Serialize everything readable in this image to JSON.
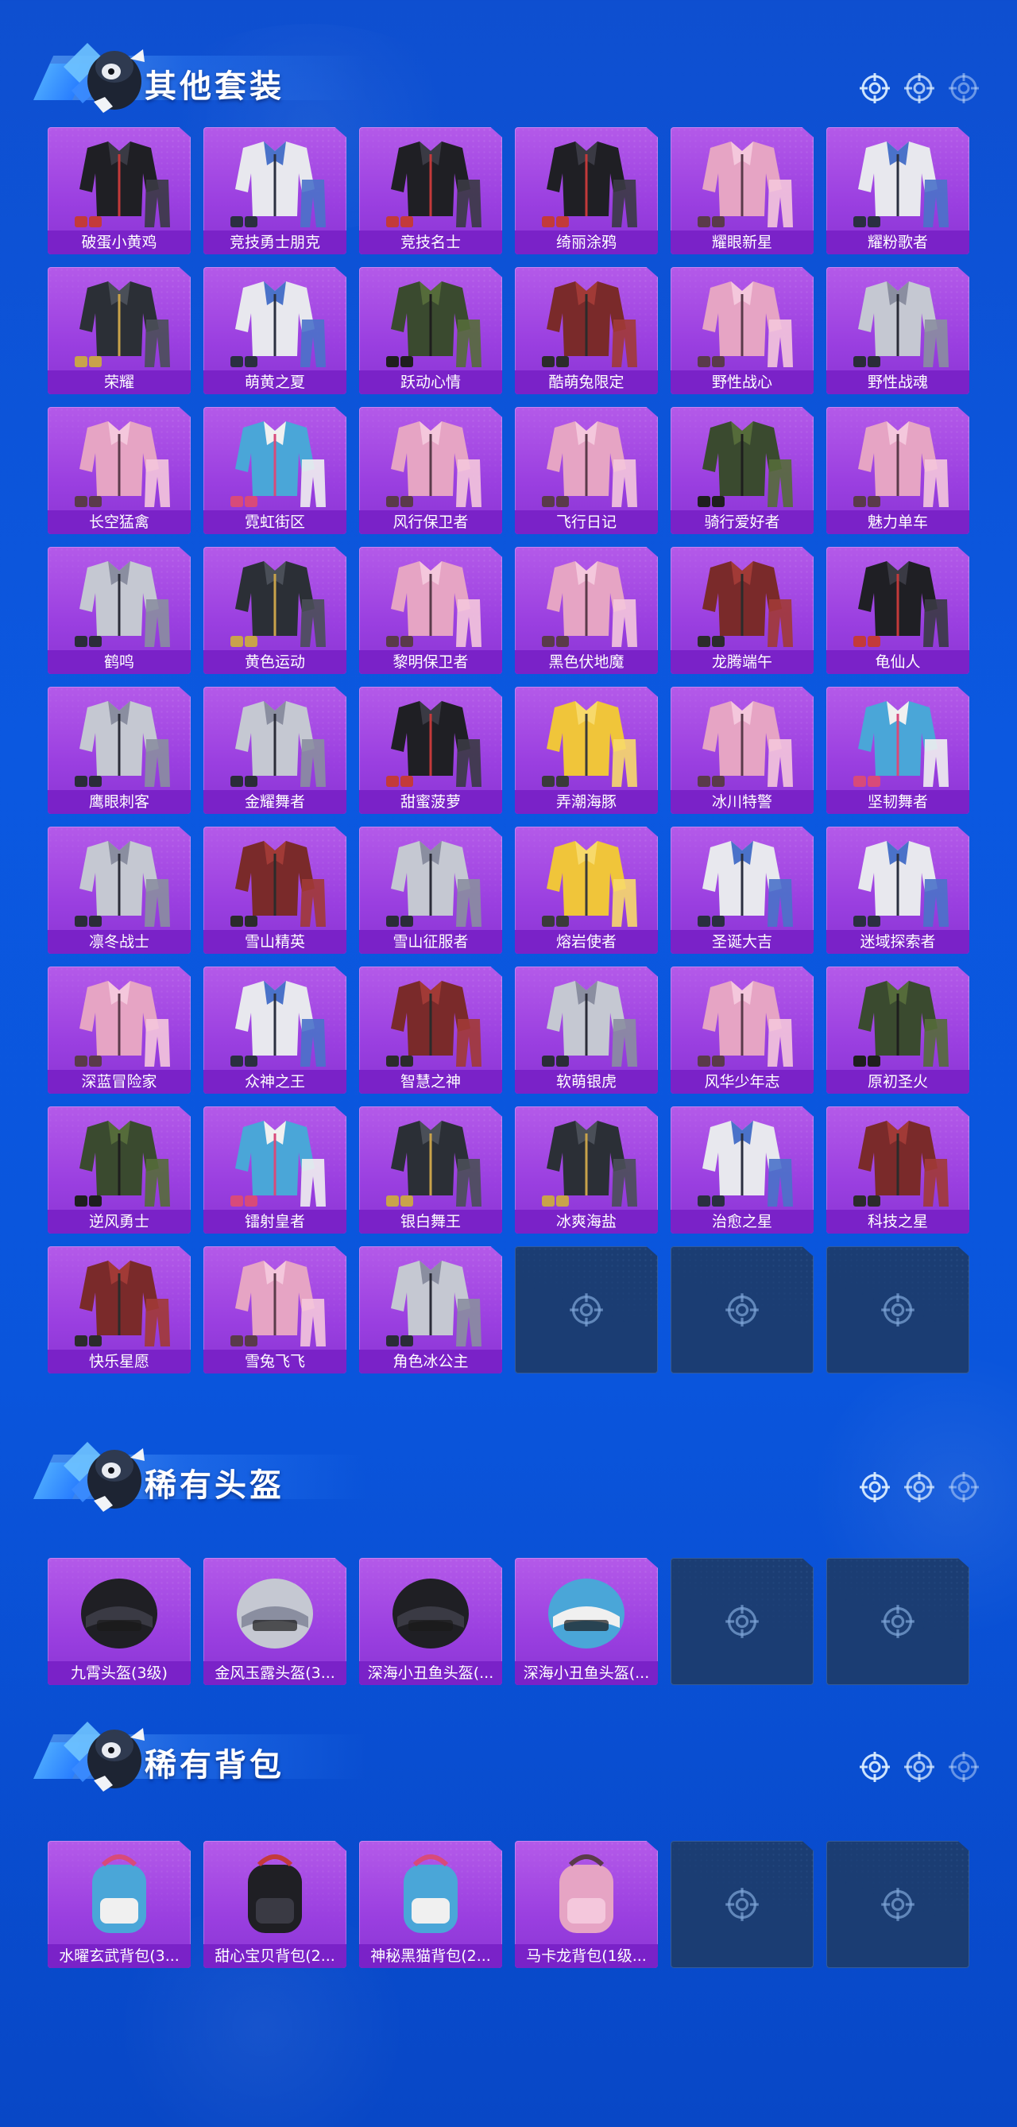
{
  "colors": {
    "card_purple": "#a64ce6",
    "label_purple": "#7a22c8",
    "empty_slot": "#1b3d73",
    "background_blue": "#0b58e0"
  },
  "sections": [
    {
      "title": "其他套装",
      "header_icons": [
        "crosshair-icon",
        "crosshair-icon",
        "crosshair-icon"
      ],
      "items": [
        {
          "label": "破蛋小黄鸡",
          "thumb": "yellow-chick"
        },
        {
          "label": "竞技勇士朋克",
          "thumb": "red-coat"
        },
        {
          "label": "竞技名士",
          "thumb": "white-blue-jacket"
        },
        {
          "label": "绮丽涂鸦",
          "thumb": "dark-jacket"
        },
        {
          "label": "耀眼新星",
          "thumb": "white-shirt"
        },
        {
          "label": "耀粉歌者",
          "thumb": "pink-outfit"
        },
        {
          "label": "荣耀",
          "thumb": "black-leather-jacket"
        },
        {
          "label": "萌黄之夏",
          "thumb": "yellow-summer"
        },
        {
          "label": "跃动心情",
          "thumb": "yellow-tracksuit"
        },
        {
          "label": "酷萌兔限定",
          "thumb": "bunny-outfit"
        },
        {
          "label": "野性战心",
          "thumb": "orange-vest"
        },
        {
          "label": "野性战魂",
          "thumb": "blue-vest"
        },
        {
          "label": "长空猛禽",
          "thumb": "camo-jacket"
        },
        {
          "label": "霓虹街区",
          "thumb": "neon-outfit"
        },
        {
          "label": "风行保卫者",
          "thumb": "black-trench"
        },
        {
          "label": "飞行日记",
          "thumb": "graffiti-jacket"
        },
        {
          "label": "骑行爱好者",
          "thumb": "rider-jacket"
        },
        {
          "label": "魅力单车",
          "thumb": "yellow-shirt"
        },
        {
          "label": "鹤鸣",
          "thumb": "blue-hoodie"
        },
        {
          "label": "黄色运动",
          "thumb": "yellow-sport"
        },
        {
          "label": "黎明保卫者",
          "thumb": "black-coat"
        },
        {
          "label": "黑色伏地魔",
          "thumb": "black-hoodie"
        },
        {
          "label": "龙腾端午",
          "thumb": "red-dragon"
        },
        {
          "label": "龟仙人",
          "thumb": "hawaiian-shirt"
        },
        {
          "label": "鹰眼刺客",
          "thumb": "assassin"
        },
        {
          "label": "金耀舞者",
          "thumb": "gold-dancer"
        },
        {
          "label": "甜蜜菠萝",
          "thumb": "pineapple"
        },
        {
          "label": "弄潮海豚",
          "thumb": "dolphin"
        },
        {
          "label": "冰川特警",
          "thumb": "white-police"
        },
        {
          "label": "坚韧舞者",
          "thumb": "white-dancer"
        },
        {
          "label": "凛冬战士",
          "thumb": "winter-soldier"
        },
        {
          "label": "雪山精英",
          "thumb": "green-coat"
        },
        {
          "label": "雪山征服者",
          "thumb": "mountaineer"
        },
        {
          "label": "熔岩使者",
          "thumb": "lava-suit"
        },
        {
          "label": "圣诞大吉",
          "thumb": "christmas"
        },
        {
          "label": "迷域探索者",
          "thumb": "explorer"
        },
        {
          "label": "深蓝冒险家",
          "thumb": "deep-blue"
        },
        {
          "label": "众神之王",
          "thumb": "god-king"
        },
        {
          "label": "智慧之神",
          "thumb": "wisdom-god"
        },
        {
          "label": "软萌银虎",
          "thumb": "silver-tiger"
        },
        {
          "label": "风华少年志",
          "thumb": "youth-uniform"
        },
        {
          "label": "原初圣火",
          "thumb": "sacred-fire"
        },
        {
          "label": "逆风勇士",
          "thumb": "armor"
        },
        {
          "label": "镭射皇者",
          "thumb": "laser-king"
        },
        {
          "label": "银白舞王",
          "thumb": "silver-dancer"
        },
        {
          "label": "冰爽海盐",
          "thumb": "sea-salt"
        },
        {
          "label": "治愈之星",
          "thumb": "healing-star"
        },
        {
          "label": "科技之星",
          "thumb": "tech-star"
        },
        {
          "label": "快乐星愿",
          "thumb": "happy-star"
        },
        {
          "label": "雪兔飞飞",
          "thumb": "snow-bunny"
        },
        {
          "label": "角色冰公主",
          "thumb": "ice-princess"
        }
      ],
      "empty_slots": 3
    },
    {
      "title": "稀有头盔",
      "header_icons": [
        "crosshair-icon",
        "crosshair-icon",
        "crosshair-icon"
      ],
      "items": [
        {
          "label": "九霄头盔(3级)",
          "thumb": "level3-helmet"
        },
        {
          "label": "金风玉露头盔(3...",
          "thumb": "golden-helmet"
        },
        {
          "label": "深海小丑鱼头盔(...",
          "thumb": "clownfish-helmet"
        },
        {
          "label": "深海小丑鱼头盔(...",
          "thumb": "clownfish-helmet-2"
        }
      ],
      "empty_slots": 2
    },
    {
      "title": "稀有背包",
      "header_icons": [
        "crosshair-icon",
        "crosshair-icon",
        "crosshair-icon"
      ],
      "items": [
        {
          "label": "水曜玄武背包(3...",
          "thumb": "turtle-backpack"
        },
        {
          "label": "甜心宝贝背包(2...",
          "thumb": "sweet-backpack"
        },
        {
          "label": "神秘黑猫背包(2...",
          "thumb": "black-cat-backpack"
        },
        {
          "label": "马卡龙背包(1级...",
          "thumb": "macaron-backpack"
        }
      ],
      "empty_slots": 2
    }
  ]
}
